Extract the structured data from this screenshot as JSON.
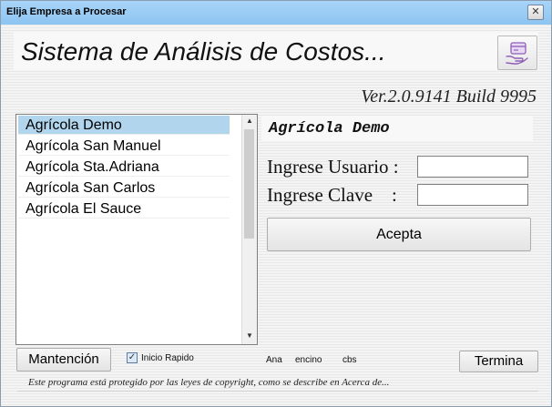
{
  "window": {
    "title": "Elija Empresa a Procesar",
    "close_glyph": "✕"
  },
  "header": {
    "app_title": "Sistema de Análisis de Costos...",
    "version": "Ver.2.0.9141 Build 9995",
    "icon": "card-in-hand-icon"
  },
  "companies": {
    "items": [
      "Agrícola Demo",
      "Agrícola San Manuel",
      "Agrícola Sta.Adriana",
      "Agrícola San Carlos",
      "Agrícola El Sauce"
    ],
    "selected": "Agrícola Demo"
  },
  "login": {
    "company_label": "Agrícola Demo",
    "user_label": "Ingrese Usuario :",
    "user_value": "",
    "password_label": "Ingrese Clave    :",
    "password_value": "",
    "accept_label": "Acepta"
  },
  "bottom": {
    "maintenance_label": "Mantención",
    "quick_start_label": "Inicio Rapido",
    "quick_start_checked": true,
    "user_names": [
      "Ana",
      "encino",
      "cbs"
    ],
    "close_label": "Termina"
  },
  "footer": {
    "copyright": "Este programa está protegido por las leyes de copyright, como se describe en Acerca de..."
  },
  "colors": {
    "titlebar": "#99cbf4",
    "selection": "#b0d5ec"
  }
}
